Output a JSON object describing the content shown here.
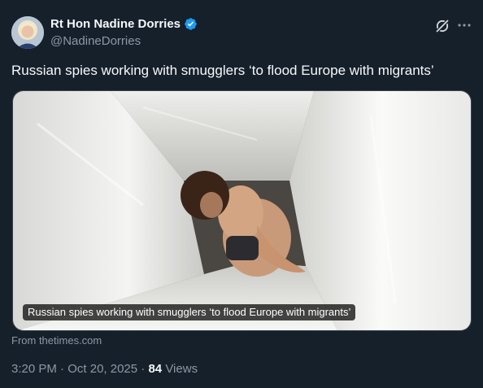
{
  "author": {
    "display_name": "Rt Hon Nadine Dorries",
    "handle": "@NadineDorries",
    "verified": true,
    "verified_color": "#1d9bf0"
  },
  "header_icons": {
    "grok": "grok-slash-icon",
    "more": "more-horizontal-icon"
  },
  "tweet": {
    "text": "Russian spies working with smugglers ‘to flood Europe with migrants’"
  },
  "card": {
    "image": "photo-person-crouching-between-white-rolls",
    "caption": "Russian spies working with smugglers ‘to flood Europe with migrants’",
    "source": "From thetimes.com"
  },
  "meta": {
    "time": "3:20 PM",
    "date": "Oct 20, 2025",
    "separator": "·",
    "views_count": "84",
    "views_label": "Views"
  },
  "colors": {
    "background": "#15202b",
    "text_primary": "#f7f9f9",
    "text_secondary": "#8b98a5"
  }
}
